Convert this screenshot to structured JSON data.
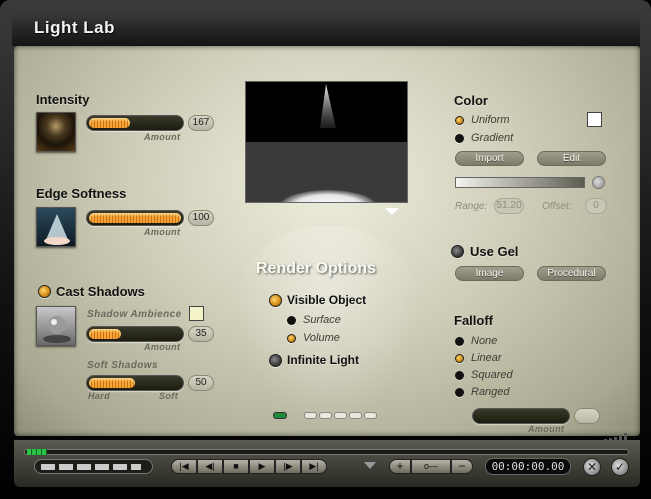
{
  "window": {
    "title": "Light  Lab"
  },
  "intensity": {
    "heading": "Intensity",
    "slider_label": "Amount",
    "value": "167",
    "fill": 0.45
  },
  "edge": {
    "heading": "Edge Softness",
    "slider_label": "Amount",
    "value": "100",
    "fill": 1.0
  },
  "shadows": {
    "heading": "Cast Shadows",
    "ambience_label": "Shadow Ambience",
    "amount_label": "Amount",
    "ambience_value": "35",
    "ambience_fill": 0.35,
    "soft_label": "Soft Shadows",
    "hard_label": "Hard",
    "softend_label": "Soft",
    "soft_value": "50",
    "soft_fill": 0.5,
    "ambience_swatch": "#f4f4c8"
  },
  "render": {
    "heading": "Render Options",
    "visible_object": "Visible Object",
    "surface": "Surface",
    "volume": "Volume",
    "infinite_light": "Infinite Light"
  },
  "color": {
    "heading": "Color",
    "uniform": "Uniform",
    "gradient": "Gradient",
    "import": "Import",
    "edit": "Edit",
    "range_label": "Range:",
    "range_value": "51.20",
    "offset_label": "Offset:",
    "offset_value": "0",
    "swatch": "#ffffff"
  },
  "gel": {
    "heading": "Use Gel",
    "image": "Image",
    "procedural": "Procedural"
  },
  "falloff": {
    "heading": "Falloff",
    "none": "None",
    "linear": "Linear",
    "squared": "Squared",
    "ranged": "Ranged",
    "amount_label": "Amount"
  },
  "timeline": {
    "time": "00:00:00.00"
  },
  "colors": {
    "accent": "#e0941c",
    "panel": "#cfcdb8"
  }
}
